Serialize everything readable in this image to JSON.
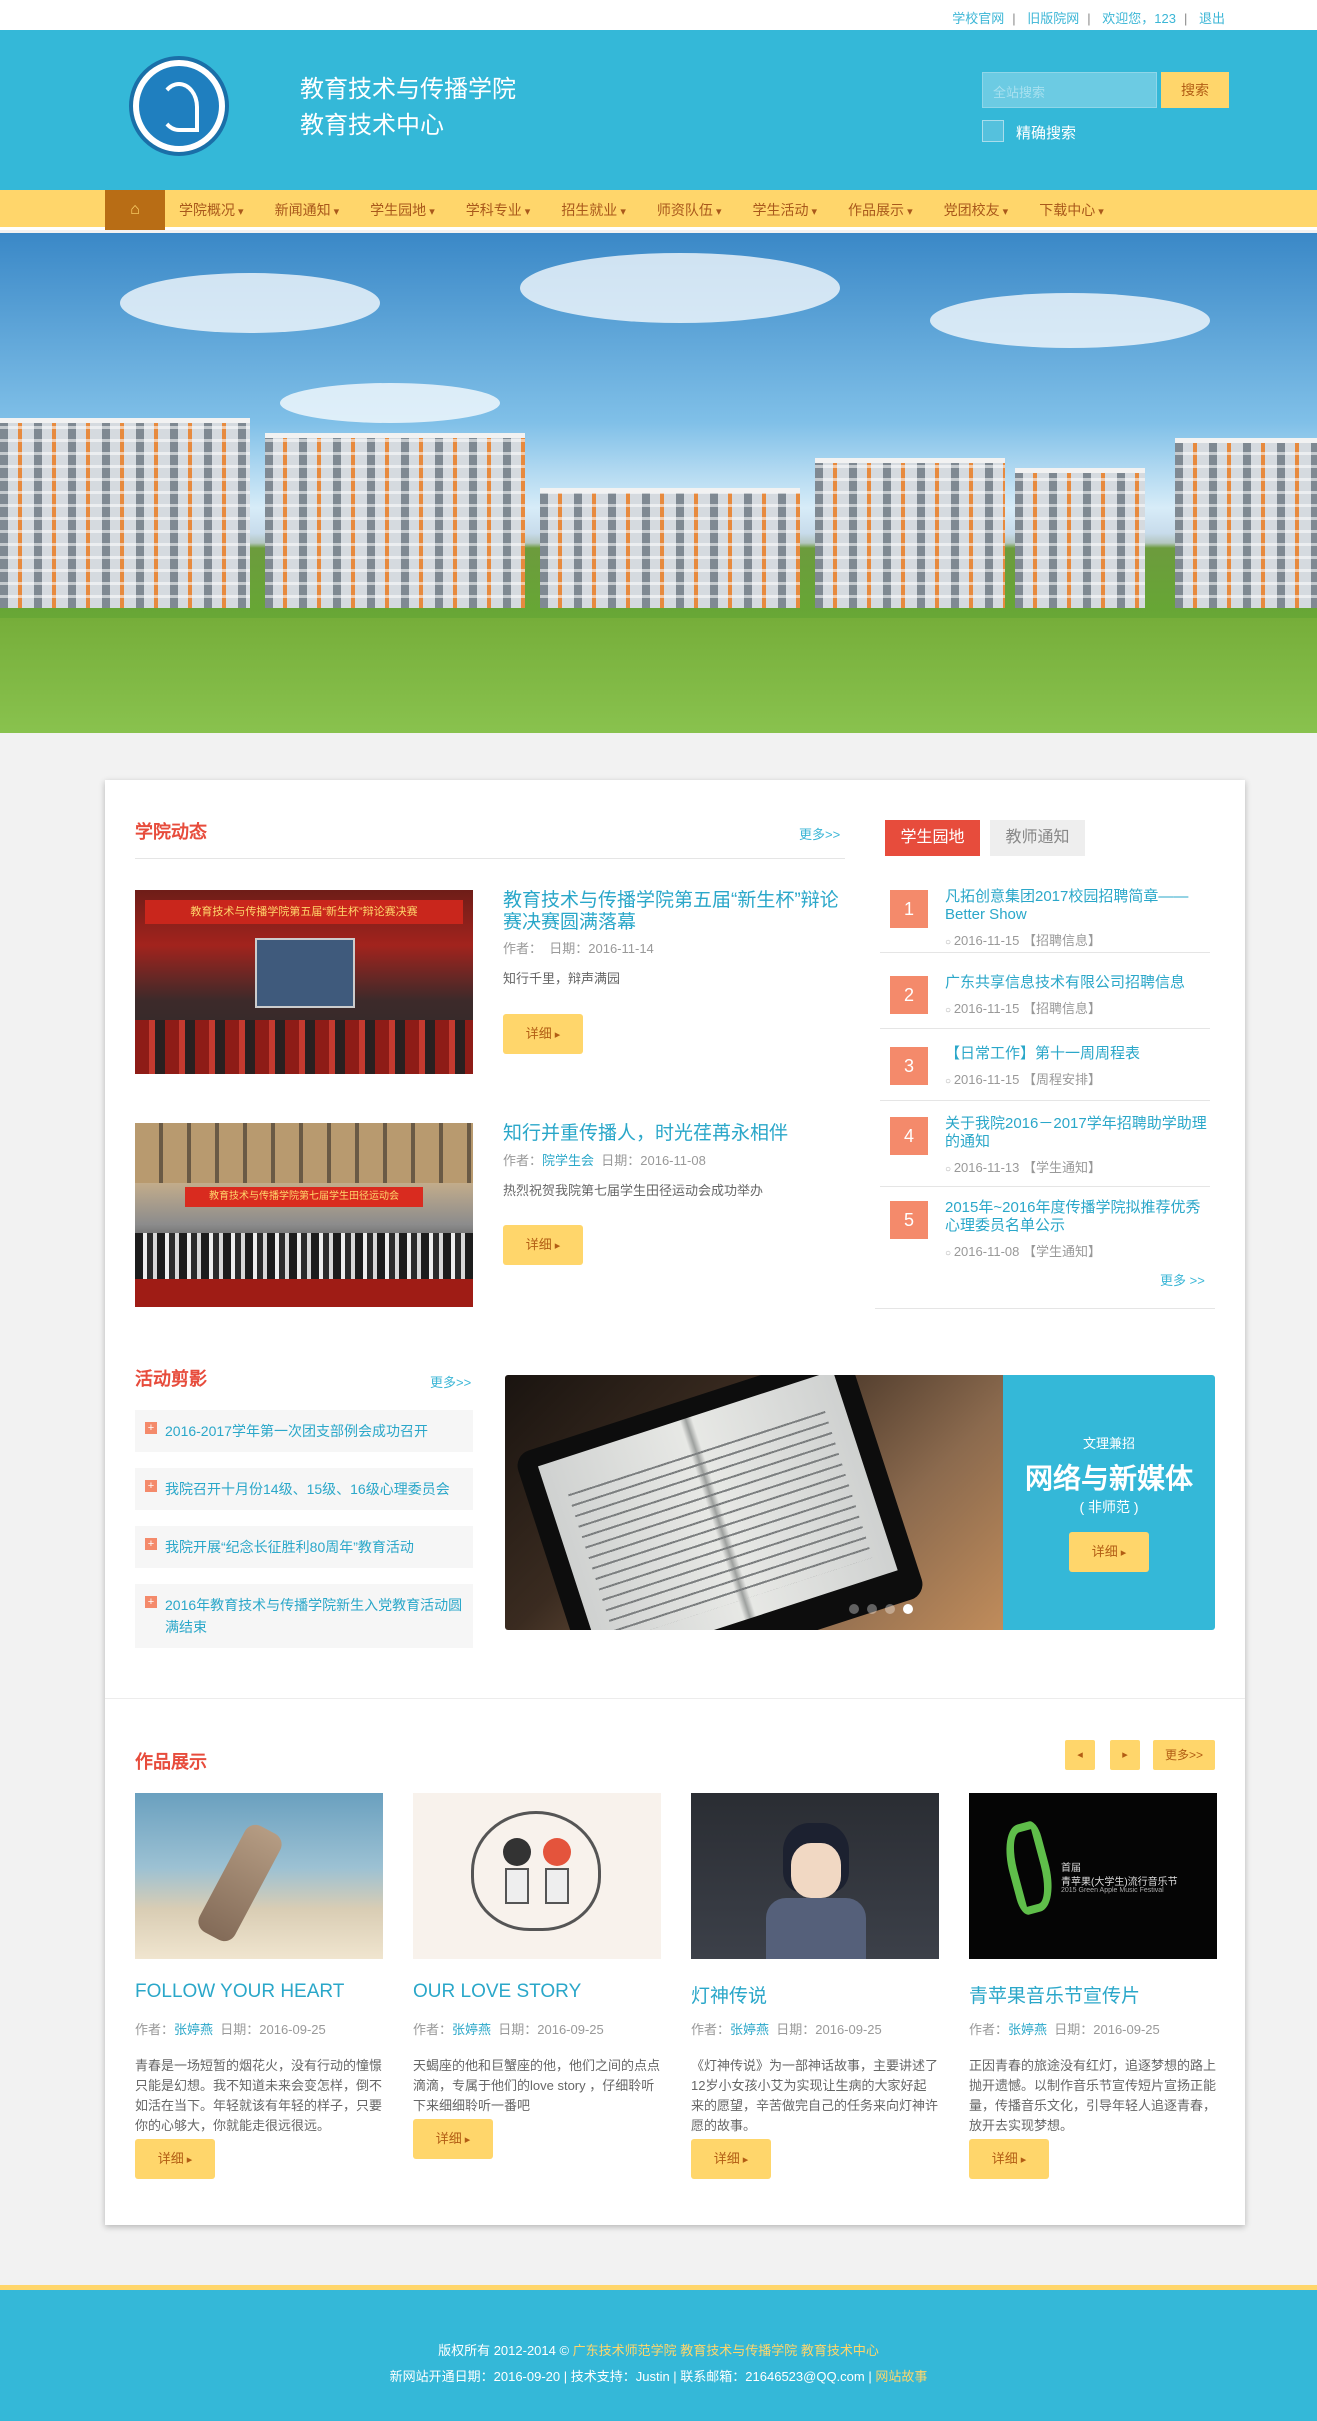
{
  "topbar": {
    "links": [
      "学校官网",
      "旧版院网",
      "欢迎您，123",
      "退出"
    ]
  },
  "header": {
    "title_line1": "教育技术与传播学院",
    "title_line2": "教育技术中心",
    "search_placeholder": "全站搜索",
    "search_button": "搜索",
    "exact_search_label": "精确搜索"
  },
  "nav": {
    "home_icon": "home-icon",
    "items": [
      "学院概况",
      "新闻通知",
      "学生园地",
      "学科专业",
      "招生就业",
      "师资队伍",
      "学生活动",
      "作品展示",
      "党团校友",
      "下载中心"
    ]
  },
  "college_news": {
    "title": "学院动态",
    "more": "更多>>",
    "items": [
      {
        "title": "教育技术与传播学院第五届“新生杯”辩论赛决赛圆满落幕",
        "author_label": "作者：",
        "author": "",
        "date": "日期：2016-11-14",
        "desc": "知行千里，辩声满园",
        "detail": "详细"
      },
      {
        "title": "知行并重传播人，时光荏苒永相伴",
        "author_label": "作者：",
        "author": "院学生会",
        "date": "日期：2016-11-08",
        "desc": "热烈祝贺我院第七届学生田径运动会成功举办",
        "detail": "详细"
      }
    ]
  },
  "side_tabs": {
    "tab1": "学生园地",
    "tab2": "教师通知",
    "more": "更多 >>",
    "items": [
      {
        "num": "1",
        "title": "凡拓创意集团2017校园招聘简章——Better Show",
        "meta": "2016-11-15 【招聘信息】"
      },
      {
        "num": "2",
        "title": "广东共享信息技术有限公司招聘信息",
        "meta": "2016-11-15 【招聘信息】"
      },
      {
        "num": "3",
        "title": "【日常工作】第十一周周程表",
        "meta": "2016-11-15 【周程安排】"
      },
      {
        "num": "4",
        "title": "关于我院2016－2017学年招聘助学助理的通知",
        "meta": "2016-11-13 【学生通知】"
      },
      {
        "num": "5",
        "title": "2015年~2016年度传播学院拟推荐优秀心理委员名单公示",
        "meta": "2016-11-08 【学生通知】"
      }
    ]
  },
  "activity": {
    "title": "活动剪影",
    "more": "更多>>",
    "items": [
      "2016-2017学年第一次团支部例会成功召开",
      "我院召开十月份14级、15级、16级心理委员会",
      "我院开展“纪念长征胜利80周年”教育活动",
      "2016年教育技术与传播学院新生入党教育活动圆满结束"
    ]
  },
  "feature": {
    "subtitle": "文理兼招",
    "title": "网络与新媒体",
    "note": "( 非师范 )",
    "detail": "详细"
  },
  "works": {
    "title": "作品展示",
    "more": "更多>>",
    "prev_icon": "arrow-left-icon",
    "next_icon": "arrow-right-icon",
    "items": [
      {
        "title": "FOLLOW YOUR HEART",
        "author_label": "作者：",
        "author": "张婷燕",
        "date": "日期：2016-09-25",
        "desc": "青春是一场短暂的烟花火，没有行动的憧憬只能是幻想。我不知道未来会变怎样，倒不如活在当下。年轻就该有年轻的样子，只要你的心够大，你就能走很远很远。",
        "detail": "详细"
      },
      {
        "title": "OUR LOVE STORY",
        "author_label": "作者：",
        "author": "张婷燕",
        "date": "日期：2016-09-25",
        "desc": "天蝎座的他和巨蟹座的他，他们之间的点点滴滴，专属于他们的love story ，仔细聆听下来细细聆听一番吧",
        "detail": "详细"
      },
      {
        "title": "灯神传说",
        "author_label": "作者：",
        "author": "张婷燕",
        "date": "日期：2016-09-25",
        "desc": "《灯神传说》为一部神话故事，主要讲述了12岁小女孩小艾为实现让生病的大家好起来的愿望，辛苦做完自己的任务来向灯神许愿的故事。",
        "detail": "详细"
      },
      {
        "title": "青苹果音乐节宣传片",
        "author_label": "作者：",
        "author": "张婷燕",
        "date": "日期：2016-09-25",
        "desc": "正因青春的旅途没有红灯，追逐梦想的路上抛开遗憾。以制作音乐节宣传短片宣扬正能量，传播音乐文化，引导年轻人追逐青春，放开去实现梦想。",
        "detail": "详细"
      }
    ],
    "poster_line1": "首届",
    "poster_line2": "青苹果(大学生)流行音乐节",
    "poster_line3": "2015 Green Apple Music Festival"
  },
  "footer": {
    "line1_prefix": "版权所有 2012-2014 © ",
    "line1_highlight": "广东技术师范学院 教育技术与传播学院 教育技术中心",
    "line2_prefix": "新网站开通日期：2016-09-20 | 技术支持：Justin | 联系邮箱：21646523@QQ.com | ",
    "line2_highlight": "网站故事"
  },
  "colors": {
    "primary_cyan": "#34b8d8",
    "accent_yellow": "#ffd66b",
    "heading_red": "#e74c3c",
    "link_blue": "#2aa7c9",
    "number_orange": "#f48a6b"
  }
}
